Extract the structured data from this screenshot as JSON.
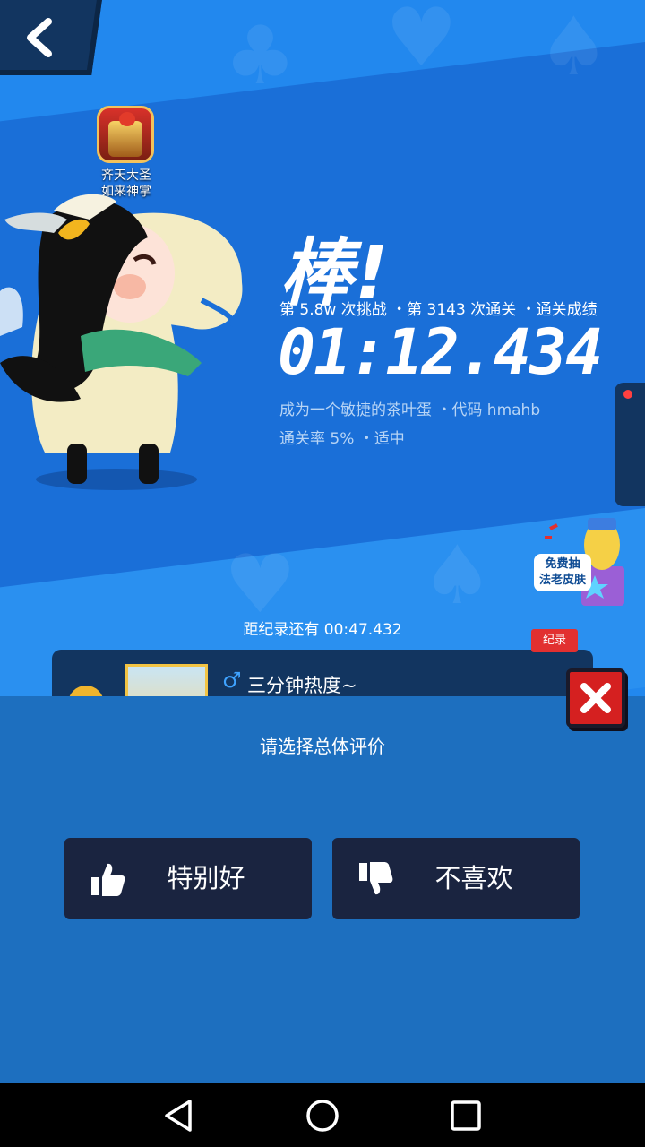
{
  "overlay": {
    "app_icon_label": "齐天大圣\n如来神掌"
  },
  "result": {
    "title": "棒!",
    "stats": "第 5.8w 次挑战 ・第 3143 次通关 ・通关成绩",
    "time": "01:12.434",
    "subtitle": "成为一个敏捷的茶叶蛋 ・代码 hmahb",
    "pass_rate": "通关率 5% ・适中"
  },
  "promo": {
    "label": "免费抽\n法老皮肤"
  },
  "leaderboard": {
    "record_gap": "距纪录还有 00:47.432",
    "record_badge": "纪录",
    "top_player_gender": "♂",
    "top_player_name": "三分钟热度~"
  },
  "rating": {
    "prompt": "请选择总体评价",
    "good_label": "特别好",
    "bad_label": "不喜欢"
  },
  "colors": {
    "background": "#2288ee",
    "panel": "#1d6fbf",
    "button": "#1a2440",
    "close": "#d52020"
  }
}
